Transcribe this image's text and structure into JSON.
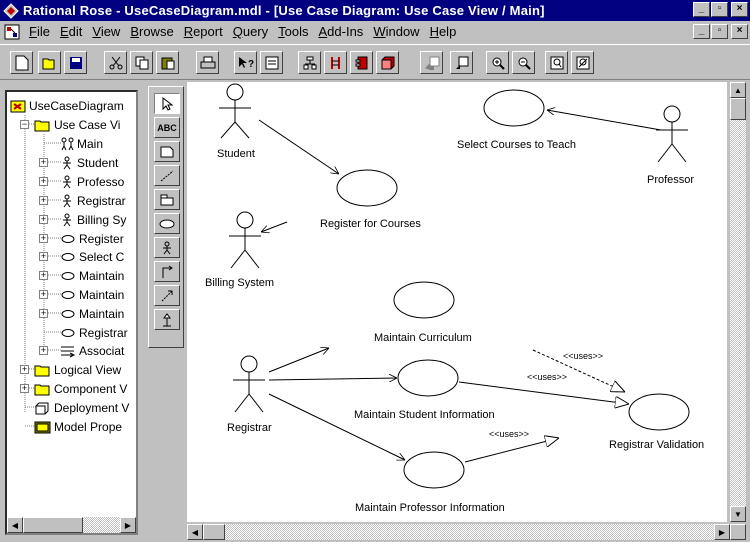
{
  "window": {
    "title": "Rational Rose - UseCaseDiagram.mdl - [Use Case Diagram: Use Case View / Main]",
    "min": "_",
    "max": "▫",
    "close": "×",
    "mdi_min": "_",
    "mdi_max": "▫",
    "mdi_close": "×"
  },
  "menu": [
    {
      "key": "F",
      "rest": "ile"
    },
    {
      "key": "E",
      "rest": "dit"
    },
    {
      "key": "V",
      "rest": "iew"
    },
    {
      "key": "B",
      "rest": "rowse"
    },
    {
      "key": "R",
      "rest": "eport"
    },
    {
      "key": "Q",
      "rest": "uery"
    },
    {
      "key": "T",
      "rest": "ools"
    },
    {
      "key": "A",
      "rest": "dd-Ins"
    },
    {
      "key": "W",
      "rest": "indow"
    },
    {
      "key": "H",
      "rest": "elp"
    }
  ],
  "browser": {
    "root": "UseCaseDiagram",
    "use_case_view": "Use Case Vi",
    "main": "Main",
    "student": "Student",
    "professor": "Professo",
    "registrar_actor": "Registrar",
    "billing": "Billing Sy",
    "register_uc": "Register",
    "select_uc": "Select C",
    "maintain1": "Maintain",
    "maintain2": "Maintain",
    "maintain3": "Maintain",
    "registrar_uc": "Registrar",
    "associations": "Associat",
    "logical_view": "Logical View",
    "component_view": "Component V",
    "deployment_view": "Deployment V",
    "model_properties": "Model Prope"
  },
  "palette": {
    "text_tool": "ABC"
  },
  "diagram": {
    "actors": {
      "student": "Student",
      "professor": "Professor",
      "billing": "Billing System",
      "registrar": "Registrar"
    },
    "use_cases": {
      "select": "Select Courses to Teach",
      "register": "Register for Courses",
      "curriculum": "Maintain Curriculum",
      "student_info": "Maintain Student Information",
      "professor_info": "Maintain Professor Information",
      "validation": "Registrar Validation"
    },
    "stereotypes": {
      "uses1": "<<uses>>",
      "uses2": "<<uses>>",
      "uses3": "<<uses>>"
    }
  }
}
